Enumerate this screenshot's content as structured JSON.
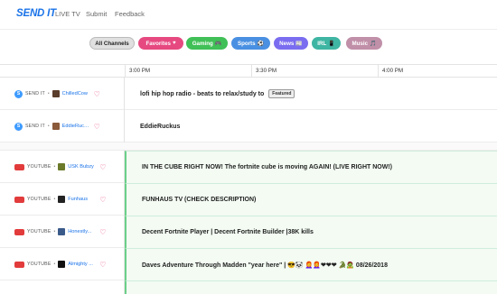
{
  "nav": {
    "logo": "SEND IT",
    "links": [
      "LIVE TV",
      "Submit",
      "Feedback"
    ]
  },
  "filters": [
    {
      "label": "All Channels",
      "icon": "",
      "color": "#e0e0e0",
      "text_color": "#222"
    },
    {
      "label": "Favorites",
      "icon": "♥",
      "color": "#e64980",
      "text_color": "#fff"
    },
    {
      "label": "Gaming",
      "icon": "🎮",
      "color": "#40c057",
      "text_color": "#fff"
    },
    {
      "label": "Sports",
      "icon": "⚽",
      "color": "#4a90e2",
      "text_color": "#fff"
    },
    {
      "label": "News",
      "icon": "📰",
      "color": "#7a6df0",
      "text_color": "#fff"
    },
    {
      "label": "IRL",
      "icon": "📱",
      "color": "#3fb5a3",
      "text_color": "#fff"
    },
    {
      "label": "Music",
      "icon": "🎵",
      "color": "#c08fa8",
      "text_color": "#fff"
    }
  ],
  "timeline": [
    "3:00 PM",
    "3:30 PM",
    "4:00 PM"
  ],
  "rows": [
    {
      "source": "SEND IT",
      "source_type": "sendit",
      "channel": "ChilledCow",
      "avatar_color": "#5a3d2b",
      "title": "lofi hip hop radio - beats to relax/study to",
      "badge": "Featured"
    },
    {
      "source": "SEND IT",
      "source_type": "sendit",
      "channel": "EddieRuck...",
      "avatar_color": "#8a5a3a",
      "title": "EddieRuckus",
      "badge": ""
    },
    {
      "source": "YOUTUBE",
      "source_type": "youtube",
      "channel": "USK Bubzy",
      "avatar_color": "#6a7a2a",
      "title": "IN THE CUBE RIGHT NOW! The fortnite cube is moving AGAIN! (LIVE RIGHT NOW!)",
      "badge": ""
    },
    {
      "source": "YOUTUBE",
      "source_type": "youtube",
      "channel": "Funhaus",
      "avatar_color": "#222",
      "title": "FUNHAUS TV (CHECK DESCRIPTION)",
      "badge": ""
    },
    {
      "source": "YOUTUBE",
      "source_type": "youtube",
      "channel": "Honestly...",
      "avatar_color": "#3a5a8a",
      "title": "Decent Fortnite Player | Decent Fortnite Builder |38K kills",
      "badge": ""
    },
    {
      "source": "YOUTUBE",
      "source_type": "youtube",
      "channel": "Almighty ...",
      "avatar_color": "#111",
      "title": "Daves Adventure Through Madden \"year here\" | 😎🐼 👩‍🦰👩‍🦰❤❤❤ 🐊🧟 08/26/2018",
      "badge": ""
    }
  ]
}
